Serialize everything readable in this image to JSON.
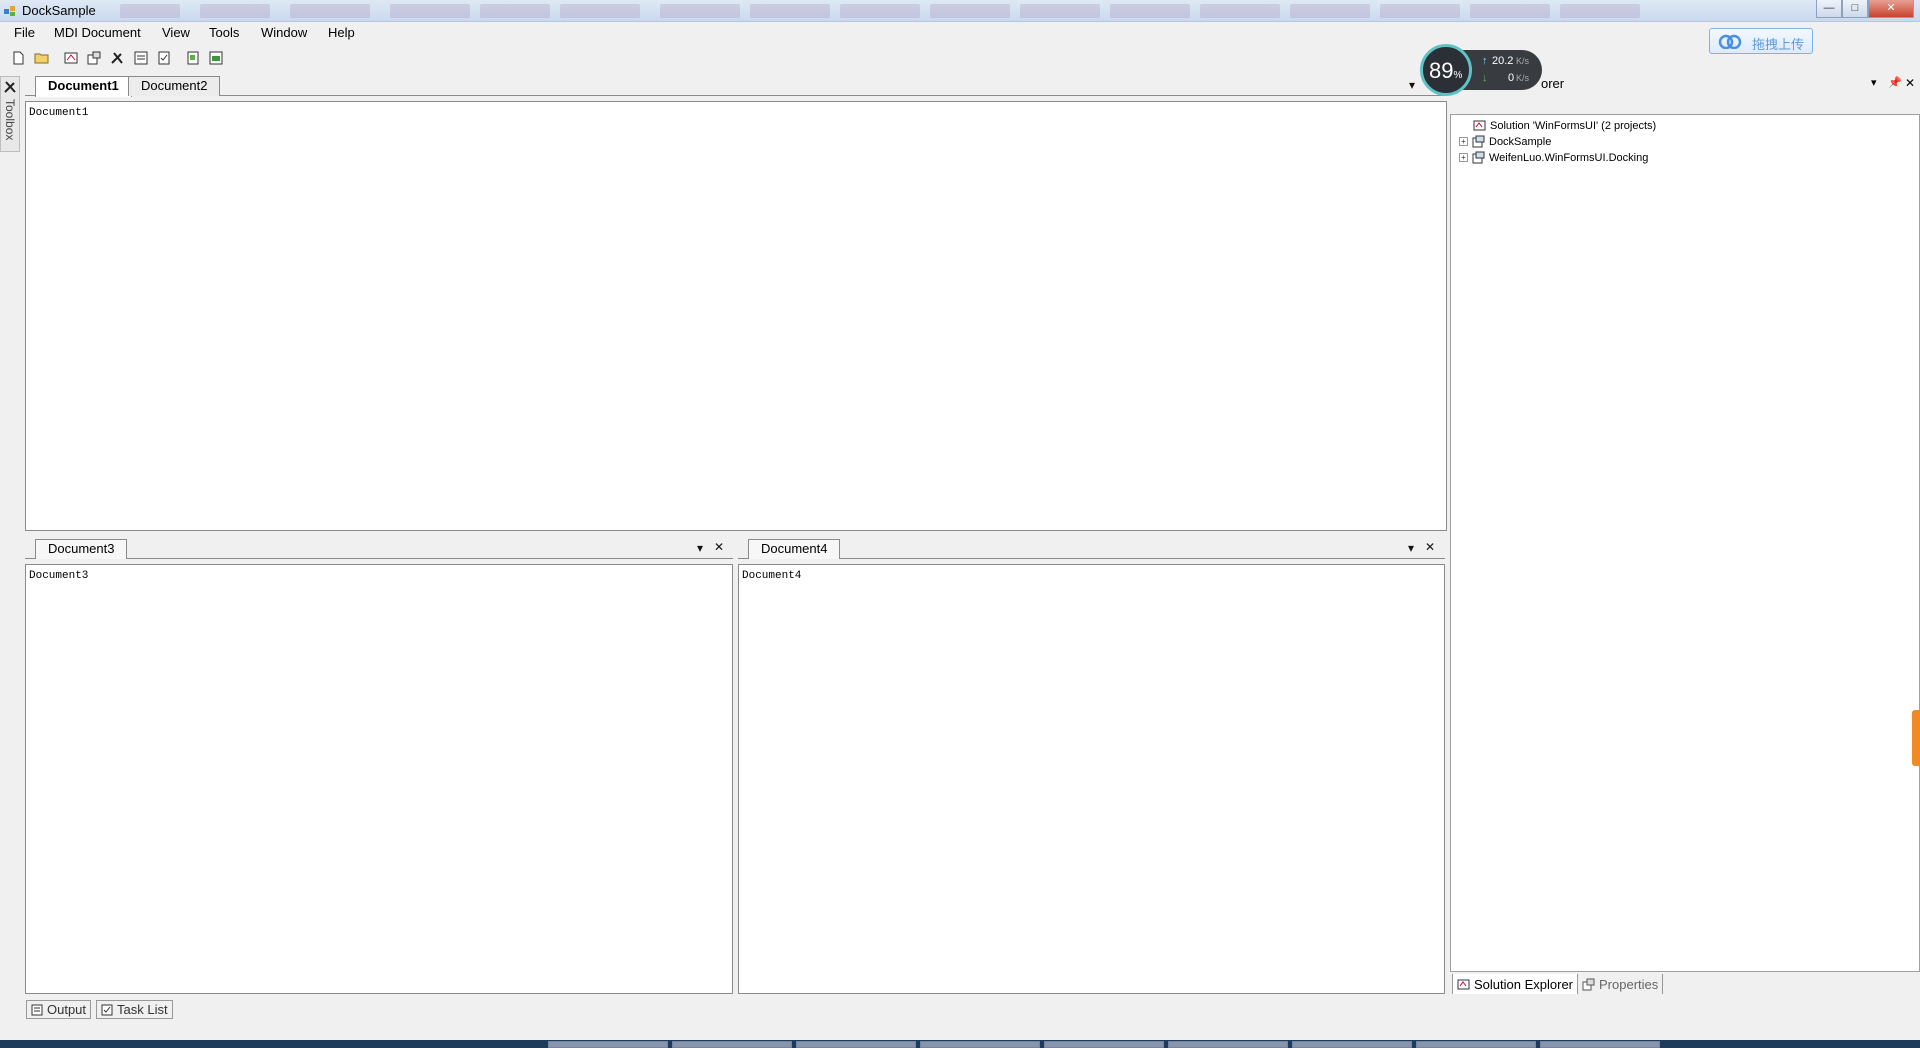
{
  "window": {
    "title": "DockSample",
    "controls": {
      "minimize": "—",
      "maximize": "□",
      "close": "✕"
    }
  },
  "menu": {
    "items": [
      "File",
      "MDI Document",
      "View",
      "Tools",
      "Window",
      "Help"
    ]
  },
  "toolbar": {
    "buttons": [
      "new-file-icon",
      "open-folder-icon",
      "solution-explorer-icon",
      "properties-icon",
      "toolbox-icon",
      "output-icon",
      "task-list-icon",
      "layout-icon",
      "schema-icon"
    ]
  },
  "upload": {
    "label": "拖拽上传"
  },
  "toolbox": {
    "label": "Toolbox"
  },
  "documents": {
    "top": {
      "tabs": [
        "Document1",
        "Document2"
      ],
      "active": "Document1",
      "content": "Document1"
    },
    "bottom_left": {
      "tabs": [
        "Document3"
      ],
      "content": "Document3"
    },
    "bottom_right": {
      "tabs": [
        "Document4"
      ],
      "content": "Document4"
    }
  },
  "solution_explorer": {
    "header_visible_text": "orer",
    "tree": [
      {
        "label": "Solution 'WinFormsUI' (2 projects)",
        "level": 0
      },
      {
        "label": "DockSample",
        "level": 1
      },
      {
        "label": "WeifenLuo.WinFormsUI.Docking",
        "level": 1
      }
    ],
    "tabs": [
      "Solution Explorer",
      "Properties"
    ]
  },
  "speed_meter": {
    "percent": "89",
    "percent_unit": "%",
    "upload": "20.2",
    "upload_unit": "K/s",
    "download": "0",
    "download_unit": "K/s"
  },
  "bottom_tabs": [
    "Output",
    "Task List"
  ],
  "colors": {
    "title_gradient_top": "#dfe9f5",
    "speed_ring": "#5ec3c6",
    "upload_arrow": "#7fd3ff",
    "download_arrow": "#4fc04f",
    "accent_orange": "#f08a24"
  }
}
